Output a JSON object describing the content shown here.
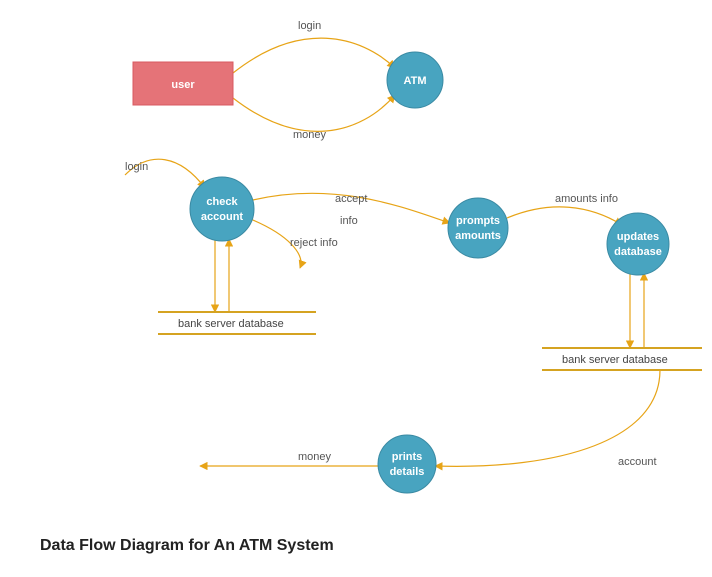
{
  "title": "Data Flow Diagram for An ATM System",
  "entities": {
    "user": {
      "label": "user"
    }
  },
  "processes": {
    "atm": {
      "label": "ATM"
    },
    "check_account": {
      "line1": "check",
      "line2": "account"
    },
    "prompts_amounts": {
      "line1": "prompts",
      "line2": "amounts"
    },
    "updates_database": {
      "line1": "updates",
      "line2": "database"
    },
    "prints_details": {
      "line1": "prints",
      "line2": "details"
    }
  },
  "datastores": {
    "ds1": {
      "label": "bank server database"
    },
    "ds2": {
      "label": "bank server database"
    }
  },
  "flows": {
    "login_top": "login",
    "money_top": "money",
    "login_left": "login",
    "accept_info_line1": "accept",
    "accept_info_line2": "info",
    "reject_info": "reject info",
    "amounts_info": "amounts info",
    "account": "account",
    "money_bottom": "money"
  },
  "colors": {
    "entity_fill": "#e57378",
    "process_fill": "#48a4c0",
    "flow_stroke": "#e7a417",
    "datastore_stroke": "#d5a321"
  }
}
